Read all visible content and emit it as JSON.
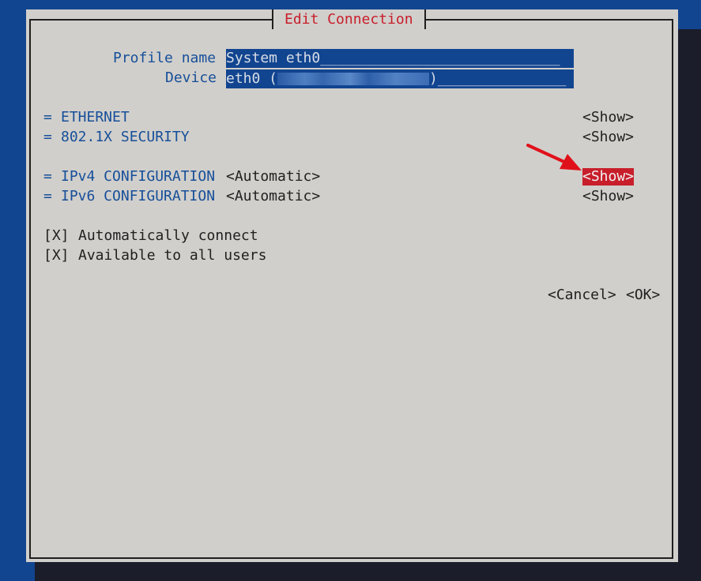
{
  "dialog": {
    "title": "Edit Connection",
    "profile_name_label": "Profile name",
    "profile_name_value": "System eth0____________________________",
    "device_label": "Device",
    "device_prefix": "eth0 (",
    "device_suffix": ")_______________",
    "sections": [
      {
        "marker": "=",
        "title": "ETHERNET",
        "value": "",
        "action": "<Show>"
      },
      {
        "marker": "=",
        "title": "802.1X SECURITY",
        "value": "",
        "action": "<Show>"
      },
      {
        "marker": "=",
        "title": "IPv4 CONFIGURATION",
        "value": "<Automatic>",
        "action": "<Show>"
      },
      {
        "marker": "=",
        "title": "IPv6 CONFIGURATION",
        "value": "<Automatic>",
        "action": "<Show>"
      }
    ],
    "checkboxes": [
      {
        "mark": "[X]",
        "label": "Automatically connect"
      },
      {
        "mark": "[X]",
        "label": "Available to all users"
      }
    ],
    "cancel_label": "<Cancel>",
    "ok_label": "<OK>"
  },
  "colors": {
    "background": "#124590",
    "dialog": "#d1cfcb",
    "accent_red": "#c81e2b",
    "label_blue": "#164f9a"
  },
  "annotation": {
    "icon": "red-arrow-icon",
    "points_to": "ipv4-show-button"
  }
}
